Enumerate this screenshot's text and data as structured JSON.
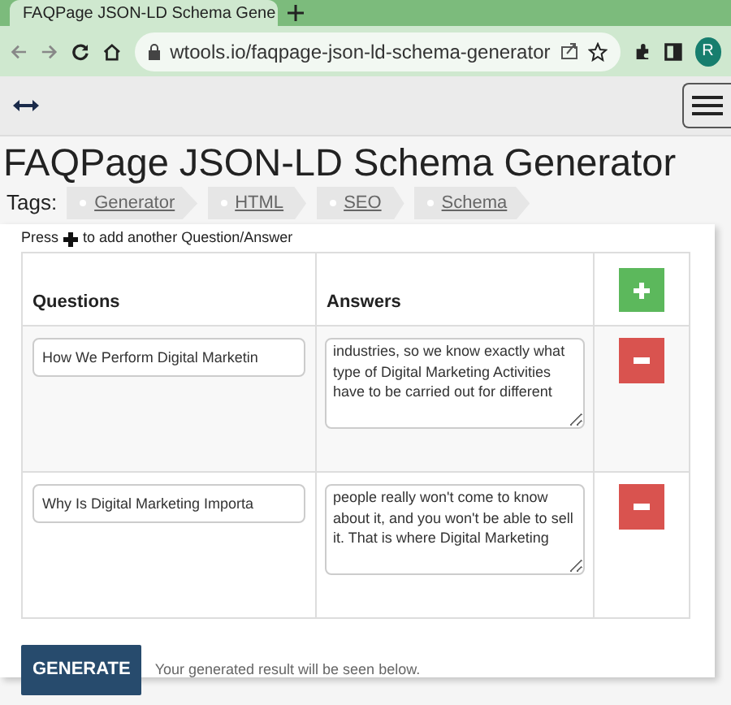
{
  "browser": {
    "tab_title": "FAQPage JSON-LD Schema Gene",
    "url": "wtools.io/faqpage-json-ld-schema-generator",
    "profile_letter": "R"
  },
  "page": {
    "title": "FAQPage JSON-LD Schema Generator",
    "tags_label": "Tags:",
    "tags": [
      "Generator",
      "HTML",
      "SEO",
      "Schema"
    ]
  },
  "form": {
    "hint_before": "Press",
    "hint_after": "to add another Question/Answer",
    "columns": [
      "Questions",
      "Answers"
    ],
    "rows": [
      {
        "question": "How We Perform Digital Marketin",
        "answer": "industries, so we know exactly what type of Digital Marketing Activities have to be carried out for different"
      },
      {
        "question": "Why Is Digital Marketing Importa",
        "answer": "people really won't come to know about it, and you won't be able to sell it. That is where Digital Marketing"
      }
    ],
    "generate_button": "GENERATE",
    "result_note": "Your generated result will be seen below."
  }
}
